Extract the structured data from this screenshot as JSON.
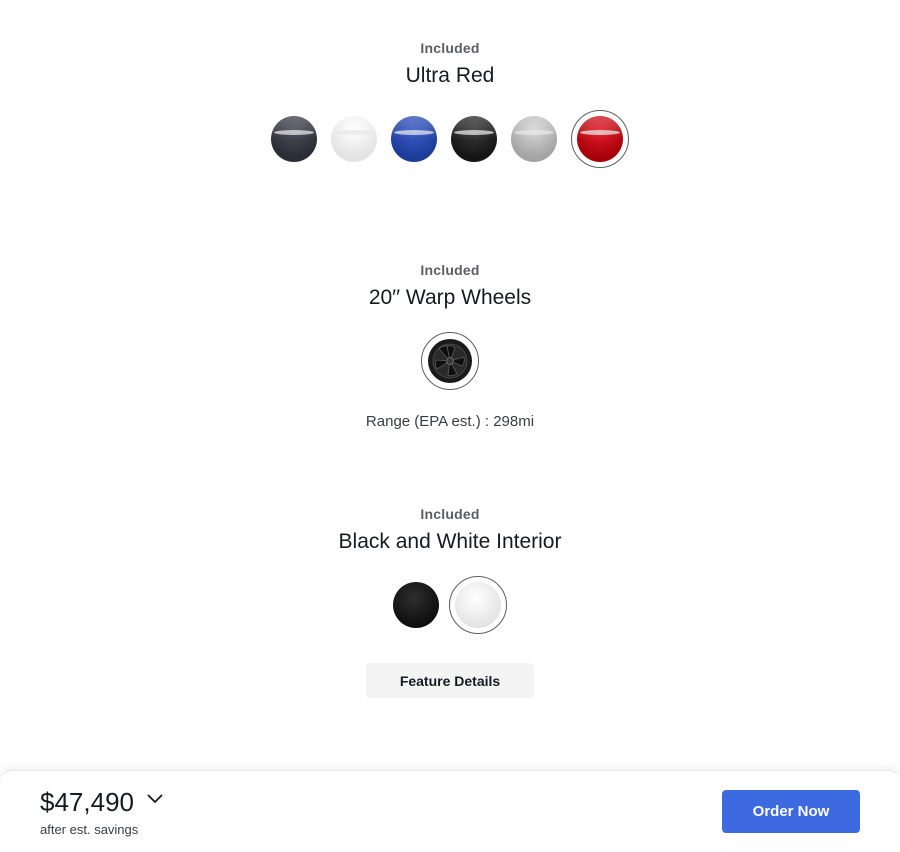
{
  "paint": {
    "included_label": "Included",
    "title": "Ultra Red",
    "options": [
      {
        "name": "midnight-silver-swatch",
        "color": "#2b2d36"
      },
      {
        "name": "pearl-white-swatch",
        "color": "#ededed"
      },
      {
        "name": "deep-blue-swatch",
        "color": "#1d3c9a"
      },
      {
        "name": "solid-black-swatch",
        "color": "#1b1b1b"
      },
      {
        "name": "quicksilver-swatch",
        "color": "#b5b5b5"
      },
      {
        "name": "ultra-red-swatch",
        "color": "#b0000c",
        "selected": true
      }
    ]
  },
  "wheels": {
    "included_label": "Included",
    "title": "20′′ Warp Wheels",
    "range_text": "Range (EPA est.) : 298mi"
  },
  "interior": {
    "included_label": "Included",
    "title": "Black and White Interior",
    "options": [
      {
        "name": "black-interior-swatch",
        "color": "#111111"
      },
      {
        "name": "white-interior-swatch",
        "color": "#f5f5f5",
        "selected": true
      }
    ],
    "feature_details_label": "Feature Details"
  },
  "footer": {
    "price": "$47,490",
    "savings_note": "after est. savings",
    "order_label": "Order Now"
  },
  "colors": {
    "accent": "#3e6ae1"
  }
}
